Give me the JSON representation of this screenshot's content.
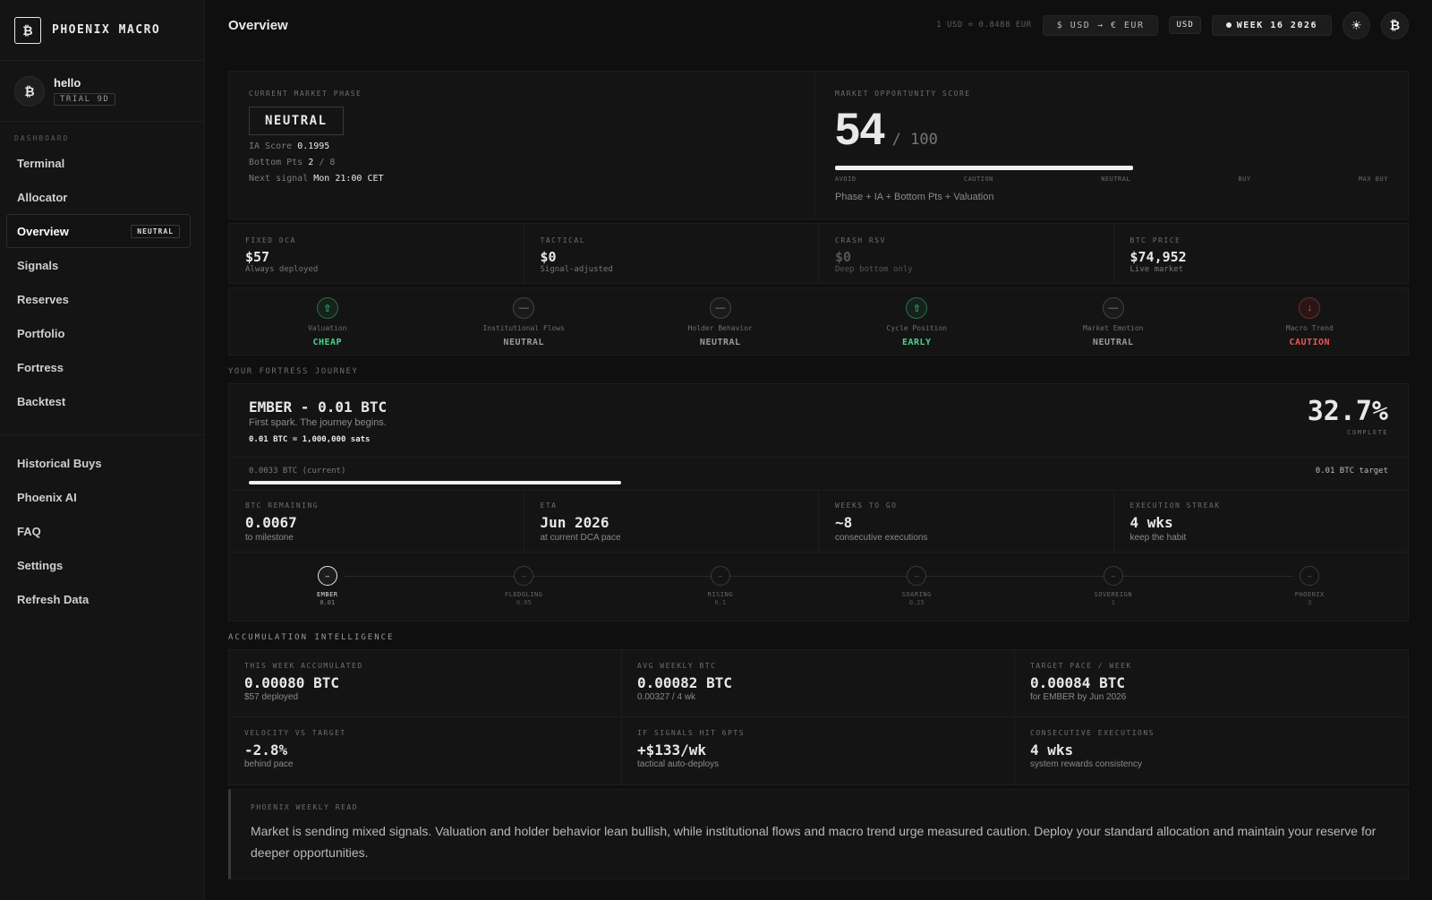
{
  "brand": {
    "logo": "₿",
    "name": "PHOENIX MACRO"
  },
  "user": {
    "avatar": "₿",
    "name": "hello",
    "badge": "TRIAL 9D"
  },
  "nav": {
    "section_label": "DASHBOARD",
    "primary": [
      {
        "label": "Terminal"
      },
      {
        "label": "Allocator"
      },
      {
        "label": "Overview",
        "badge": "NEUTRAL",
        "active": true
      },
      {
        "label": "Signals"
      },
      {
        "label": "Reserves"
      },
      {
        "label": "Portfolio"
      },
      {
        "label": "Fortress"
      },
      {
        "label": "Backtest"
      }
    ],
    "secondary": [
      {
        "label": "Historical Buys"
      },
      {
        "label": "Phoenix AI"
      },
      {
        "label": "FAQ"
      },
      {
        "label": "Settings"
      },
      {
        "label": "Refresh Data"
      }
    ]
  },
  "header": {
    "title": "Overview",
    "rate": "1 USD = 0.8488 EUR",
    "currency_toggle": "$ USD → € EUR",
    "currency": "USD",
    "week": "WEEK 16 2026",
    "theme_icon": "☀",
    "logo_icon": "₿"
  },
  "phase": {
    "label": "CURRENT MARKET PHASE",
    "value": "NEUTRAL",
    "ia_label": "IA Score",
    "ia_value": "0.1995",
    "bottom_label": "Bottom Pts",
    "bottom_value": "2",
    "bottom_of": "/ 8",
    "next_label": "Next signal",
    "next_value": "Mon 21:00 CET"
  },
  "score": {
    "label": "MARKET OPPORTUNITY SCORE",
    "value": "54",
    "max": "/ 100",
    "fill_fraction": 0.54,
    "scale": [
      "AVOID",
      "CAUTION",
      "NEUTRAL",
      "BUY",
      "MAX BUY"
    ],
    "note": "Phase + IA + Bottom Pts + Valuation"
  },
  "allocations": [
    {
      "label": "FIXED DCA",
      "value": "$57",
      "sub": "Always deployed",
      "dim": false
    },
    {
      "label": "TACTICAL",
      "value": "$0",
      "sub": "Signal-adjusted",
      "dim": false
    },
    {
      "label": "CRASH RSV",
      "value": "$0",
      "sub": "Deep bottom only",
      "dim": true
    },
    {
      "label": "BTC PRICE",
      "value": "$74,952",
      "sub": "Live market",
      "dim": false
    }
  ],
  "signals": [
    {
      "name": "Valuation",
      "state": "CHEAP",
      "tone": "green",
      "icon": "⇧"
    },
    {
      "name": "Institutional Flows",
      "state": "NEUTRAL",
      "tone": "neutral",
      "icon": "—"
    },
    {
      "name": "Holder Behavior",
      "state": "NEUTRAL",
      "tone": "neutral",
      "icon": "—"
    },
    {
      "name": "Cycle Position",
      "state": "EARLY",
      "tone": "green",
      "icon": "⇧"
    },
    {
      "name": "Market Emotion",
      "state": "NEUTRAL",
      "tone": "neutral",
      "icon": "—"
    },
    {
      "name": "Macro Trend",
      "state": "CAUTION",
      "tone": "red",
      "icon": "↓"
    }
  ],
  "journey": {
    "section": "YOUR FORTRESS JOURNEY",
    "title": "EMBER - 0.01 BTC",
    "desc": "First spark. The journey begins.",
    "sats": "0.01 BTC = 1,000,000 sats",
    "pct": "32.7%",
    "pct_label": "COMPLETE",
    "current": "0.0033 BTC (current)",
    "target": "0.01 BTC target",
    "progress_fraction": 0.327,
    "stats": [
      {
        "label": "BTC REMAINING",
        "value": "0.0067",
        "sub": "to milestone"
      },
      {
        "label": "ETA",
        "value": "Jun 2026",
        "sub": "at current DCA pace"
      },
      {
        "label": "WEEKS TO GO",
        "value": "~8",
        "sub": "consecutive executions"
      },
      {
        "label": "EXECUTION STREAK",
        "value": "4 wks",
        "sub": "keep the habit"
      }
    ],
    "milestones": [
      {
        "name": "EMBER",
        "value": "0.01",
        "current": true
      },
      {
        "name": "FLEDGLING",
        "value": "0.05",
        "current": false
      },
      {
        "name": "RISING",
        "value": "0.1",
        "current": false
      },
      {
        "name": "SOARING",
        "value": "0.25",
        "current": false
      },
      {
        "name": "SOVEREIGN",
        "value": "1",
        "current": false
      },
      {
        "name": "PHOENIX",
        "value": "3",
        "current": false
      }
    ]
  },
  "accumulation": {
    "section": "ACCUMULATION INTELLIGENCE",
    "cards": [
      {
        "label": "THIS WEEK ACCUMULATED",
        "value": "0.00080 BTC",
        "sub": "$57 deployed"
      },
      {
        "label": "AVG WEEKLY BTC",
        "value": "0.00082 BTC",
        "sub": "0.00327 / 4 wk"
      },
      {
        "label": "TARGET PACE / WEEK",
        "value": "0.00084 BTC",
        "sub": "for EMBER by Jun 2026"
      },
      {
        "label": "VELOCITY VS TARGET",
        "value": "-2.8%",
        "sub": "behind pace"
      },
      {
        "label": "IF SIGNALS HIT 6PTS",
        "value": "+$133/wk",
        "sub": "tactical auto-deploys"
      },
      {
        "label": "CONSECUTIVE EXECUTIONS",
        "value": "4 wks",
        "sub": "system rewards consistency"
      }
    ]
  },
  "weekly_read": {
    "label": "PHOENIX WEEKLY READ",
    "text": "Market is sending mixed signals. Valuation and holder behavior lean bullish, while institutional flows and macro trend urge measured caution. Deploy your standard allocation and maintain your reserve for deeper opportunities."
  }
}
